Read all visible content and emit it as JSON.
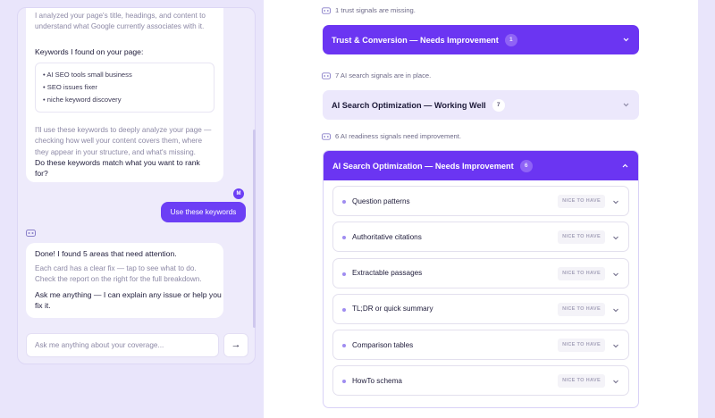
{
  "chat": {
    "bot_intro": "I analyzed your page's title, headings, and content to understand what Google currently associates with it.",
    "keywords_heading": "Keywords I found on your page:",
    "keywords": [
      "AI SEO tools small business",
      "SEO issues fixer",
      "niche keyword discovery"
    ],
    "analysis_note": "I'll use these keywords to deeply analyze your page — checking how well your content covers them, where they appear in your structure, and what's missing.",
    "question": "Do these keywords match what you want to rank for?",
    "user_avatar": "M",
    "user_action": "Use these keywords",
    "done_text": "Done! I found 5 areas that need attention.",
    "cards_hint": "Each card has a clear fix — tap to see what to do. Check the report on the right for the full breakdown.",
    "ask_text": "Ask me anything — I can explain any issue or help you fix it.",
    "input_placeholder": "Ask me anything about your coverage...",
    "send_icon": "arrow-right"
  },
  "report": {
    "signal_1": "1 trust signals are missing.",
    "section_1": {
      "title": "Trust & Conversion — Needs Improvement",
      "count": "1"
    },
    "signal_2": "7 AI search signals are in place.",
    "section_2": {
      "title": "AI Search Optimization — Working Well",
      "count": "7"
    },
    "signal_3": "6 AI readiness signals need improvement.",
    "section_3": {
      "title": "AI Search Optimization — Needs Improvement",
      "count": "6",
      "items": [
        {
          "label": "Question patterns",
          "tag": "NICE TO HAVE"
        },
        {
          "label": "Authoritative citations",
          "tag": "NICE TO HAVE"
        },
        {
          "label": "Extractable passages",
          "tag": "NICE TO HAVE"
        },
        {
          "label": "TL;DR or quick summary",
          "tag": "NICE TO HAVE"
        },
        {
          "label": "Comparison tables",
          "tag": "NICE TO HAVE"
        },
        {
          "label": "HowTo schema",
          "tag": "NICE TO HAVE"
        }
      ]
    }
  },
  "colors": {
    "accent": "#6b35f2",
    "page_bg": "#e9e5fb",
    "light_section": "#ece8fc"
  }
}
